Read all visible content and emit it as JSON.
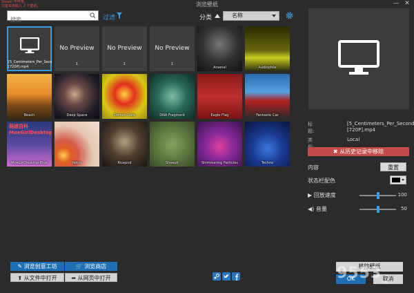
{
  "window": {
    "title": "浏览壁纸",
    "warning_lines": [
      "Steam 不可用。",
      "只能本地载入 2 个壁纸。"
    ],
    "buttons": [
      "—",
      "✕"
    ]
  },
  "toolbar": {
    "search_placeholder": "搜索",
    "filter_label": "过滤",
    "sort_label": "分类",
    "sort_value": "名称"
  },
  "tiles": [
    {
      "caption": "[5_Centimeters_Per_Second][720P].mp4",
      "type": "monitor",
      "selected": true
    },
    {
      "no_preview": "No Preview",
      "num": "1",
      "type": "nop"
    },
    {
      "no_preview": "No Preview",
      "num": "1",
      "type": "nop"
    },
    {
      "no_preview": "No Preview",
      "num": "1",
      "type": "nop"
    },
    {
      "caption": "Arsenal",
      "type": "img",
      "bg": "radial-gradient(circle at 50% 40%, #777 0%, #333 50%, #111 100%)"
    },
    {
      "caption": "Audiophile",
      "type": "img",
      "bg": "linear-gradient(180deg,#2a2a00 0%,#6a6a10 55%,#c8d020 70%,#2a2a10 100%)"
    },
    {
      "caption": "Beach",
      "type": "img",
      "bg": "linear-gradient(180deg,#f2b347 0%,#e68c2a 45%,#7a4a18 70%,#3c2a12 100%)"
    },
    {
      "caption": "Deep Space",
      "type": "img",
      "bg": "radial-gradient(circle at 45% 45%, #c9a48a 0%, #6a4a46 30%, #1e1a26 70%, #0c0c14 100%)"
    },
    {
      "caption": "Demon Core",
      "type": "img",
      "bg": "radial-gradient(circle at 50% 45%, #ffd23a 0%, #e2301d 30%, #d8c818 65%, #9a8a10 100%)"
    },
    {
      "caption": "DNA Fragment",
      "type": "img",
      "bg": "radial-gradient(circle at 50% 50%, #7fbda6 0%, #2a6b5a 45%, #0f2a24 100%)"
    },
    {
      "caption": "Eagle Flag",
      "type": "img",
      "bg": "linear-gradient(180deg,#8a1a1a 0%,#c03030 50%,#7a1414 100%)"
    },
    {
      "caption": "Fantastic Car",
      "type": "img",
      "bg": "linear-gradient(180deg,#2a6ab0 0%,#56a0e0 40%,#b02020 60%,#2a2a2a 100%)"
    },
    {
      "caption": "MoeGirlDesktop-Blue",
      "type": "moe",
      "bigtext": "萌娘百科 MoeGirlDesktop",
      "bg": "linear-gradient(180deg,#2a3a7a 0%,#5a4aa0 50%,#d06ad0 100%)"
    },
    {
      "caption": "Retro",
      "type": "img",
      "bg": "radial-gradient(circle at 20% 75%, #ffcc55 0%, #e06020 15%, #d45a4a 30%, #e6c8b4 60%, #f0e0d4 100%)"
    },
    {
      "caption": "Ricepod",
      "type": "img",
      "bg": "radial-gradient(circle at 50% 45%, #b0a080 0%, #504030 45%, #1a1410 100%)"
    },
    {
      "caption": "Sheepit",
      "type": "img",
      "bg": "radial-gradient(circle at 50% 50%, #8aa060 0%, #607840 50%, #3a4a28 100%)"
    },
    {
      "caption": "Shimmering Particles",
      "type": "img",
      "bg": "radial-gradient(circle at 50% 55%, #e040a0 0%, #8a2a9a 40%, #3a1450 100%)"
    },
    {
      "caption": "Techno",
      "type": "img",
      "bg": "radial-gradient(circle at 50% 60%, #3a78e0 0%, #1a3a90 45%, #0a1440 100%)"
    }
  ],
  "details": {
    "title_key": "标题:",
    "title_val": "[5_Centimeters_Per_Second][720P].mp4",
    "type_key": "类型:",
    "type_val": "Local",
    "remove_history": "✖ 从历史记录中移除",
    "content_label": "内容",
    "reset": "重置",
    "statusbar_color": "状态栏配色",
    "speed_label": "▶ 回放速度",
    "speed_value": "100",
    "speed_frac": 0.5,
    "volume_label": "◀) 音量",
    "volume_value": "50",
    "volume_frac": 0.5
  },
  "bottom": {
    "workshop": "✎ 浏览创意工坊",
    "shop": "🛒 浏览商店",
    "open_file": "⬆ 从文件中打开",
    "open_web": "➦ 从网页中打开",
    "remove_wallpaper": "移除壁纸",
    "ok": "OK",
    "cancel": "取消",
    "watermark": "9553",
    "watermark_sub": "下载"
  }
}
